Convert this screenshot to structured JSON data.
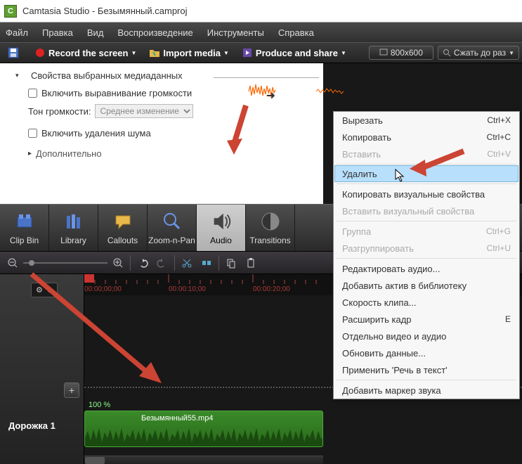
{
  "titlebar": {
    "title": "Camtasia Studio - Безымянный.camproj"
  },
  "menu": {
    "file": "Файл",
    "edit": "Правка",
    "view": "Вид",
    "play": "Воспроизведение",
    "tools": "Инструменты",
    "help": "Справка"
  },
  "toolbar": {
    "record": "Record the screen",
    "import": "Import media",
    "produce": "Produce and share",
    "size": "800x600",
    "shrink": "Сжать до раз"
  },
  "properties": {
    "title": "Свойства выбранных медиаданных",
    "autolevel": "Включить выравнивание громкости",
    "tonelabel": "Тон громкости:",
    "toneselect": "Среднее изменение гро",
    "denoise": "Включить удаления шума",
    "additional": "Дополнительно"
  },
  "tabs": {
    "clipbin": "Clip Bin",
    "library": "Library",
    "callouts": "Callouts",
    "zoom": "Zoom-n-Pan",
    "audio": "Audio",
    "transitions": "Transitions"
  },
  "timeline": {
    "ticks": [
      "00:00;00;00",
      "00:00:10;00",
      "00:00:20;00"
    ],
    "trackname": "Дорожка 1",
    "percent": "100 %",
    "clipname": "Безымянный55.mp4"
  },
  "context": {
    "cut": {
      "label": "Вырезать",
      "key": "Ctrl+X"
    },
    "copy": {
      "label": "Копировать",
      "key": "Ctrl+C"
    },
    "paste": {
      "label": "Вставить",
      "key": "Ctrl+V"
    },
    "delete": {
      "label": "Удалить",
      "key": ""
    },
    "copyvis": {
      "label": "Копировать визуальные свойства",
      "key": ""
    },
    "pastevis": {
      "label": "Вставить визуальный свойства",
      "key": ""
    },
    "group": {
      "label": "Группа",
      "key": "Ctrl+G"
    },
    "ungroup": {
      "label": "Разгруппировать",
      "key": "Ctrl+U"
    },
    "editaudio": {
      "label": "Редактировать аудио...",
      "key": ""
    },
    "addasset": {
      "label": "Добавить актив в библиотеку",
      "key": ""
    },
    "speed": {
      "label": "Скорость клипа...",
      "key": ""
    },
    "extend": {
      "label": "Расширить кадр",
      "key": "E"
    },
    "splitav": {
      "label": "Отдельно видео и аудио",
      "key": ""
    },
    "refresh": {
      "label": "Обновить данные...",
      "key": ""
    },
    "speech": {
      "label": "Применить 'Речь в текст'",
      "key": ""
    },
    "marker": {
      "label": "Добавить маркер звука",
      "key": ""
    }
  }
}
